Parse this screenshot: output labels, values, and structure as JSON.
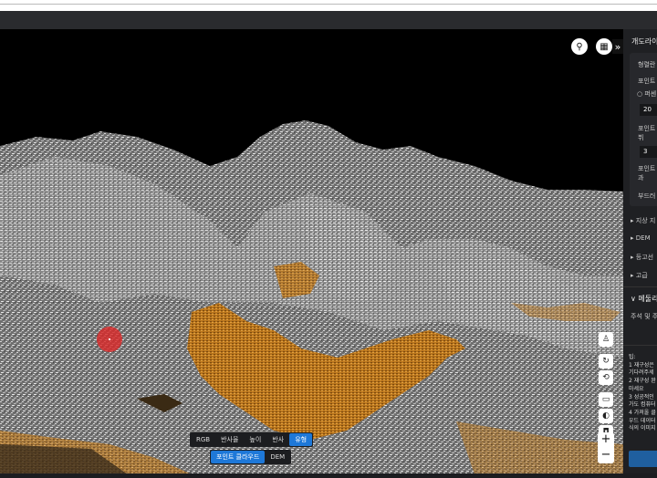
{
  "viewer": {
    "top_icons": [
      "filter-icon",
      "layers-icon",
      "measure-icon"
    ],
    "expand_label": "»",
    "modes": [
      {
        "label": "RGB",
        "active": false
      },
      {
        "label": "반사율",
        "active": false
      },
      {
        "label": "높이",
        "active": false
      },
      {
        "label": "반사",
        "active": false
      },
      {
        "label": "유형",
        "active": true
      }
    ],
    "render_modes": [
      {
        "label": "포인트 클라우드",
        "active": true
      },
      {
        "label": "DEM",
        "active": false
      }
    ],
    "zoom_in": "+",
    "zoom_out": "−"
  },
  "panel": {
    "title": "개도라이",
    "card": {
      "label1": "형렬란",
      "label2": "포인트",
      "radio_label": "퍼센",
      "value1": "20",
      "label3a": "포인트",
      "label3b": "뷔",
      "value2": "3",
      "label4a": "포인트",
      "label4b": "과",
      "label5": "부드러"
    },
    "sections": [
      {
        "label": "지상 지"
      },
      {
        "label": "DEM"
      },
      {
        "label": "등고선"
      },
      {
        "label": "고급"
      }
    ],
    "annotation": {
      "label": "메둘리",
      "text": "주석 및 주"
    },
    "tips": [
      "팁:",
      "1 재구성은",
      "기다려주세",
      "2 재구성 완",
      "마세요",
      "3 성공적인",
      "가도 컴퓨터",
      "4 가져올 클",
      "우드 데이터",
      "식의 이미지"
    ]
  },
  "colors": {
    "accent": "#1e78d8",
    "terrain_gray": "#8e8e8e",
    "terrain_orange": "#c07a20"
  }
}
